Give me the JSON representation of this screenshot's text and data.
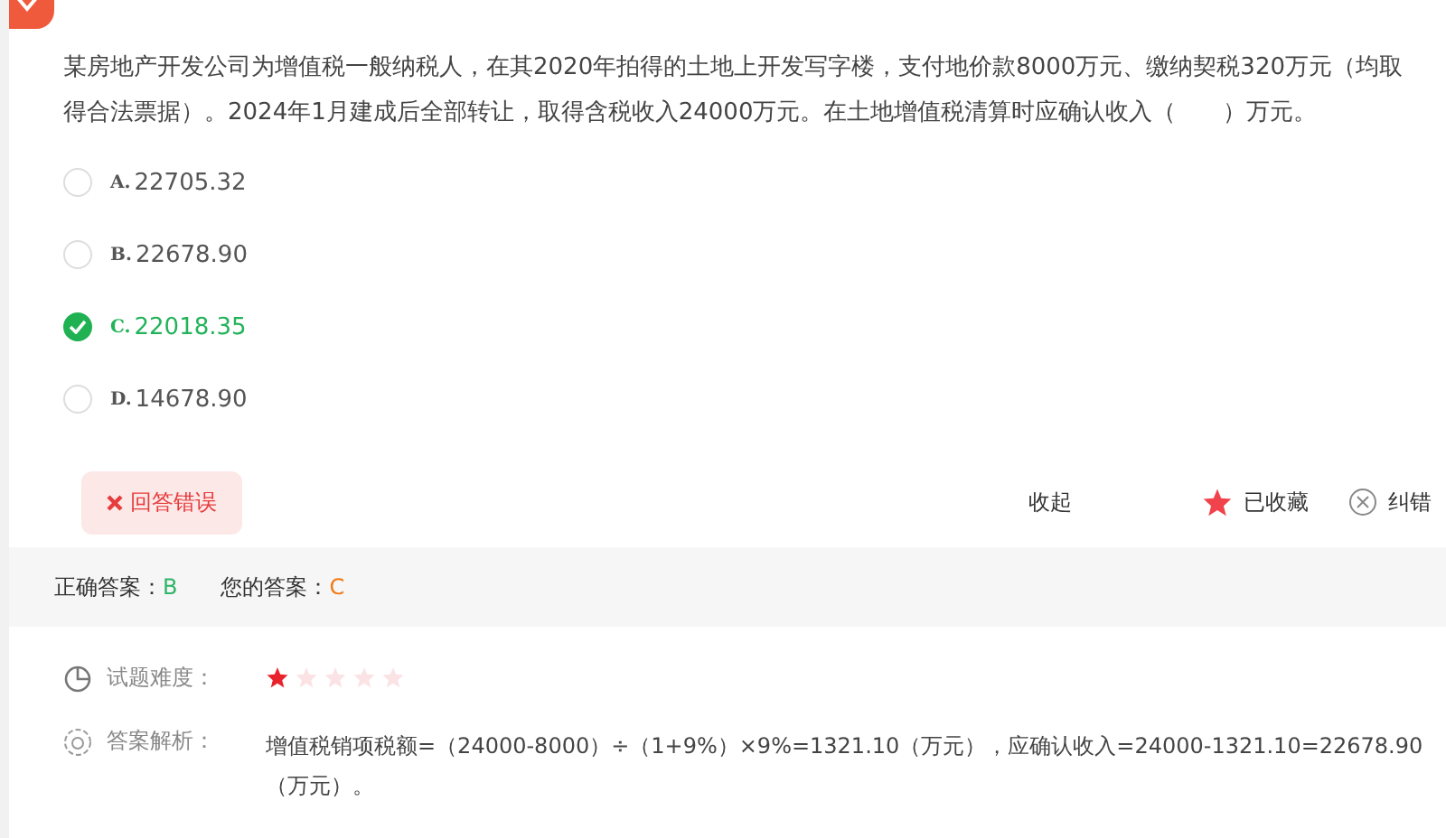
{
  "question": {
    "text": "某房地产开发公司为增值税一般纳税人，在其2020年拍得的土地上开发写字楼，支付地价款8000万元、缴纳契税320万元（均取得合法票据）。2024年1月建成后全部转让，取得含税收入24000万元。在土地增值税清算时应确认收入（　　）万元。"
  },
  "options": [
    {
      "letter": "A.",
      "text": "22705.32",
      "selected": false
    },
    {
      "letter": "B.",
      "text": "22678.90",
      "selected": false
    },
    {
      "letter": "C.",
      "text": "22018.35",
      "selected": true
    },
    {
      "letter": "D.",
      "text": "14678.90",
      "selected": false
    }
  ],
  "result_badge": {
    "label": "回答错误"
  },
  "actions": [
    {
      "kind": "text",
      "label": "收起"
    },
    {
      "kind": "favorite",
      "label": "已收藏"
    },
    {
      "kind": "report",
      "label": "纠错"
    }
  ],
  "answers": [
    {
      "label": "正确答案：",
      "value": "B",
      "color": "#2fb56a"
    },
    {
      "label": "您的答案：",
      "value": "C",
      "color": "#f07a16"
    }
  ],
  "difficulty": {
    "label": "试题难度：",
    "stars": 1
  },
  "analysis": {
    "label": "答案解析：",
    "text": "增值税销项税额=（24000-8000）÷（1+9%）×9%=1321.10（万元），应确认收入=24000-1321.10=22678.90（万元）。"
  }
}
